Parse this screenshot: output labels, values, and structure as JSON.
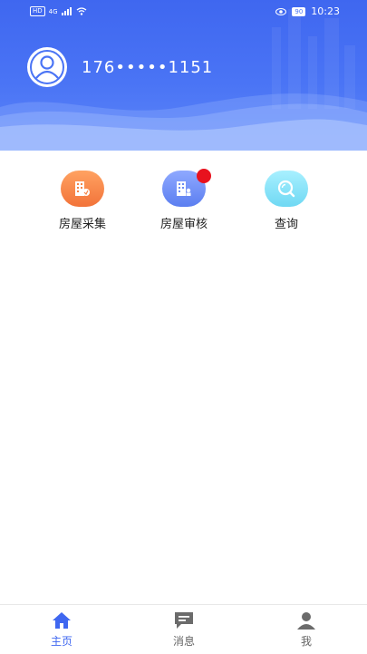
{
  "status_bar": {
    "left_tag": "HD",
    "network": "4G",
    "battery": "90",
    "time": "10:23"
  },
  "profile": {
    "phone": "176•••••1151",
    "avatar_icon": "user-avatar-icon"
  },
  "actions": [
    {
      "label": "房屋采集",
      "icon": "building-collect-icon",
      "color": "#f58446"
    },
    {
      "label": "房屋审核",
      "icon": "building-audit-icon",
      "color": "#6c8cf3",
      "has_badge": true,
      "badge_color": "#e8121e"
    },
    {
      "label": "查询",
      "icon": "search-icon",
      "color": "#86e2f7"
    }
  ],
  "nav": {
    "active_color": "#3f67f0",
    "inactive_color": "#666666",
    "items": [
      {
        "label": "主页",
        "icon": "home-icon",
        "active": true
      },
      {
        "label": "消息",
        "icon": "message-icon",
        "active": false
      },
      {
        "label": "我",
        "icon": "person-icon",
        "active": false
      }
    ]
  }
}
